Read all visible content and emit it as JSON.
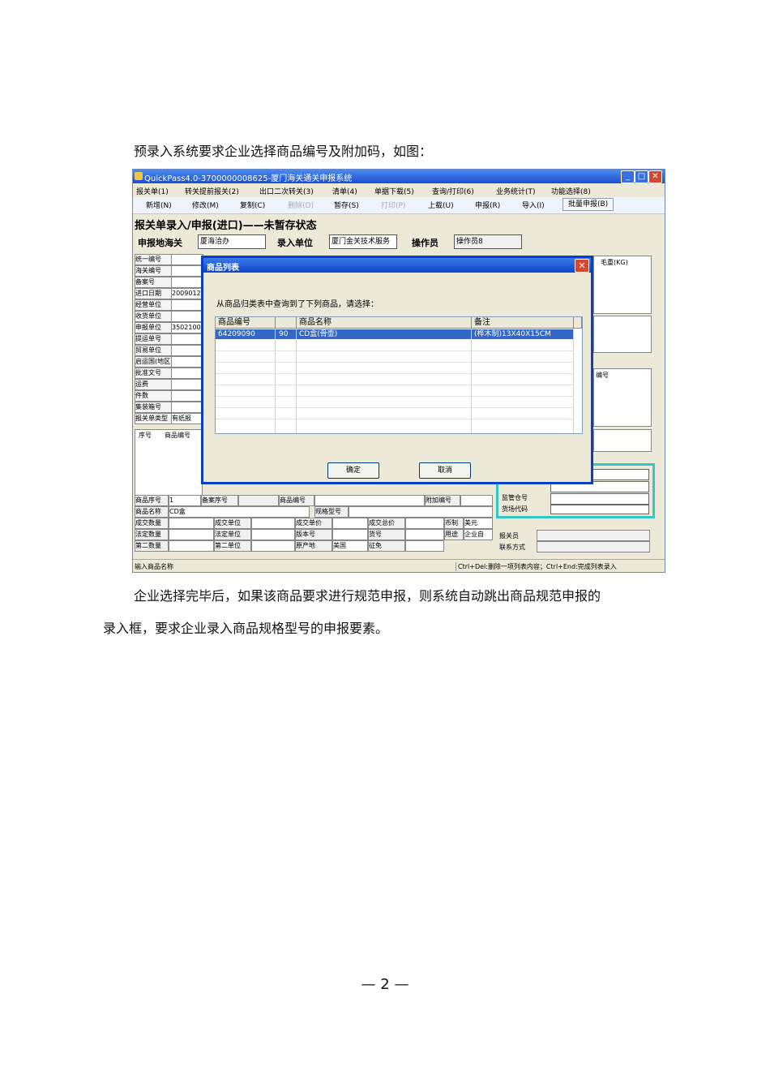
{
  "doc": {
    "intro": "预录入系统要求企业选择商品编号及附加码，如图：",
    "after_line1": "企业选择完毕后，如果该商品要求进行规范申报，则系统自动跳出商品规范申报的",
    "after_line2": "录入框，要求企业录入商品规格型号的申报要素。",
    "page_number": "— 2 —"
  },
  "window": {
    "title": "QuickPass4.0-3700000008625-厦门海关通关申报系统",
    "menus": [
      "报关单(1)",
      "转关提前报关(2)",
      "出口二次转关(3)",
      "清单(4)",
      "单据下载(5)",
      "查询/打印(6)",
      "业务统计(T)",
      "功能选择(8)"
    ],
    "toolbar": [
      "新增(N)",
      "修改(M)",
      "复制(C)",
      "删除(D)",
      "暂存(S)",
      "打印(P)",
      "上载(U)",
      "申报(R)",
      "导入(I)",
      "批量申报(B)"
    ],
    "form_title": "报关单录入/申报(进口)——未暂存状态",
    "header": {
      "customs_label": "申报地海关",
      "customs_value": "厦海洽办",
      "entry_unit_label": "录入单位",
      "entry_unit_value": "厦门金关技术服务",
      "operator_label": "操作员",
      "operator_value": "操作员8"
    },
    "left_labels": [
      "统一编号",
      "海关编号",
      "备案号",
      "进口日期",
      "经营单位",
      "收货单位",
      "申报单位",
      "提运单号",
      "贸易单位",
      "启运国(地区)",
      "批准文号",
      "运费",
      "件数",
      "集装箱号",
      "报关单类型"
    ],
    "left_values": [
      "",
      "",
      "",
      "2009012",
      "",
      "",
      "3502100",
      "",
      "",
      "",
      "",
      "",
      "",
      "",
      "有纸报"
    ],
    "right_header": "毛重(KG)",
    "right_header2": "编号",
    "list_headers": [
      "序号",
      "商品编号"
    ],
    "bottom": {
      "row1": [
        "商品序号",
        "1",
        "备案序号",
        "",
        "商品编号",
        "",
        "附加编号",
        ""
      ],
      "row2": [
        "商品名称",
        "CD盒",
        "规格型号",
        ""
      ],
      "row3": [
        "成交数量",
        "",
        "成交单位",
        "",
        "成交单价",
        "",
        "成交总价",
        "",
        "币制",
        "美元"
      ],
      "row4": [
        "法定数量",
        "",
        "法定单位",
        "",
        "版本号",
        "",
        "货号",
        "",
        "用途",
        "企业自"
      ],
      "row5": [
        "第二数量",
        "",
        "第二单位",
        "",
        "原产地",
        "美国",
        "征免",
        ""
      ],
      "right1": [
        "监管仓号",
        "货场代码"
      ],
      "right2": [
        "报关员",
        "联系方式"
      ]
    },
    "status_left": "输入商品名称",
    "status_right": "Ctrl+Del:删除一项列表内容；Ctrl+End:完成列表录入"
  },
  "dialog": {
    "title": "商品列表",
    "message": "从商品归类表中查询到了下列商品，请选择：",
    "columns": [
      "商品编号",
      "",
      "商品名称",
      "备注"
    ],
    "rows": [
      [
        "64209090",
        "90",
        "CD盒(骨壶)",
        "(桦木制)13X40X15CM"
      ]
    ],
    "ok_label": "确定",
    "cancel_label": "取消"
  }
}
